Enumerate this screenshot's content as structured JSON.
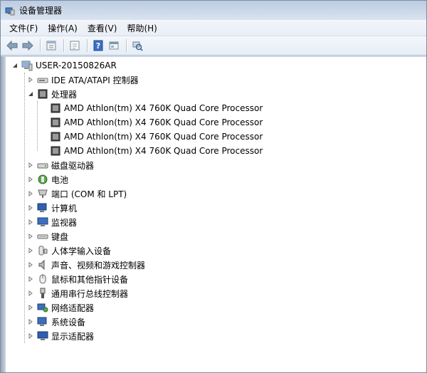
{
  "window": {
    "title": "设备管理器"
  },
  "menu": [
    {
      "label": "文件(F)"
    },
    {
      "label": "操作(A)"
    },
    {
      "label": "查看(V)"
    },
    {
      "label": "帮助(H)"
    }
  ],
  "toolbar": {
    "buttons": [
      "back-icon",
      "forward-icon",
      "properties-icon",
      "show-hide-icon",
      "help-icon",
      "console-tree-icon",
      "scan-hardware-icon"
    ]
  },
  "tree": {
    "root": {
      "label": "USER-20150826AR",
      "expanded": true
    },
    "items": [
      {
        "label": "IDE ATA/ATAPI 控制器",
        "icon": "ide-controller-icon",
        "expanded": false
      },
      {
        "label": "处理器",
        "icon": "processor-icon",
        "expanded": true,
        "children": [
          {
            "label": "AMD Athlon(tm) X4 760K Quad Core Processor"
          },
          {
            "label": "AMD Athlon(tm) X4 760K Quad Core Processor"
          },
          {
            "label": "AMD Athlon(tm) X4 760K Quad Core Processor"
          },
          {
            "label": "AMD Athlon(tm) X4 760K Quad Core Processor"
          }
        ]
      },
      {
        "label": "磁盘驱动器",
        "icon": "disk-drive-icon",
        "expanded": false
      },
      {
        "label": "电池",
        "icon": "battery-icon",
        "expanded": false
      },
      {
        "label": "端口 (COM 和 LPT)",
        "icon": "port-icon",
        "expanded": false
      },
      {
        "label": "计算机",
        "icon": "computer-icon",
        "expanded": false
      },
      {
        "label": "监视器",
        "icon": "monitor-icon",
        "expanded": false
      },
      {
        "label": "键盘",
        "icon": "keyboard-icon",
        "expanded": false
      },
      {
        "label": "人体学输入设备",
        "icon": "hid-icon",
        "expanded": false
      },
      {
        "label": "声音、视频和游戏控制器",
        "icon": "sound-icon",
        "expanded": false
      },
      {
        "label": "鼠标和其他指针设备",
        "icon": "mouse-icon",
        "expanded": false
      },
      {
        "label": "通用串行总线控制器",
        "icon": "usb-icon",
        "expanded": false
      },
      {
        "label": "网络适配器",
        "icon": "network-adapter-icon",
        "expanded": false
      },
      {
        "label": "系统设备",
        "icon": "system-device-icon",
        "expanded": false
      },
      {
        "label": "显示适配器",
        "icon": "display-adapter-icon",
        "expanded": false
      }
    ]
  }
}
